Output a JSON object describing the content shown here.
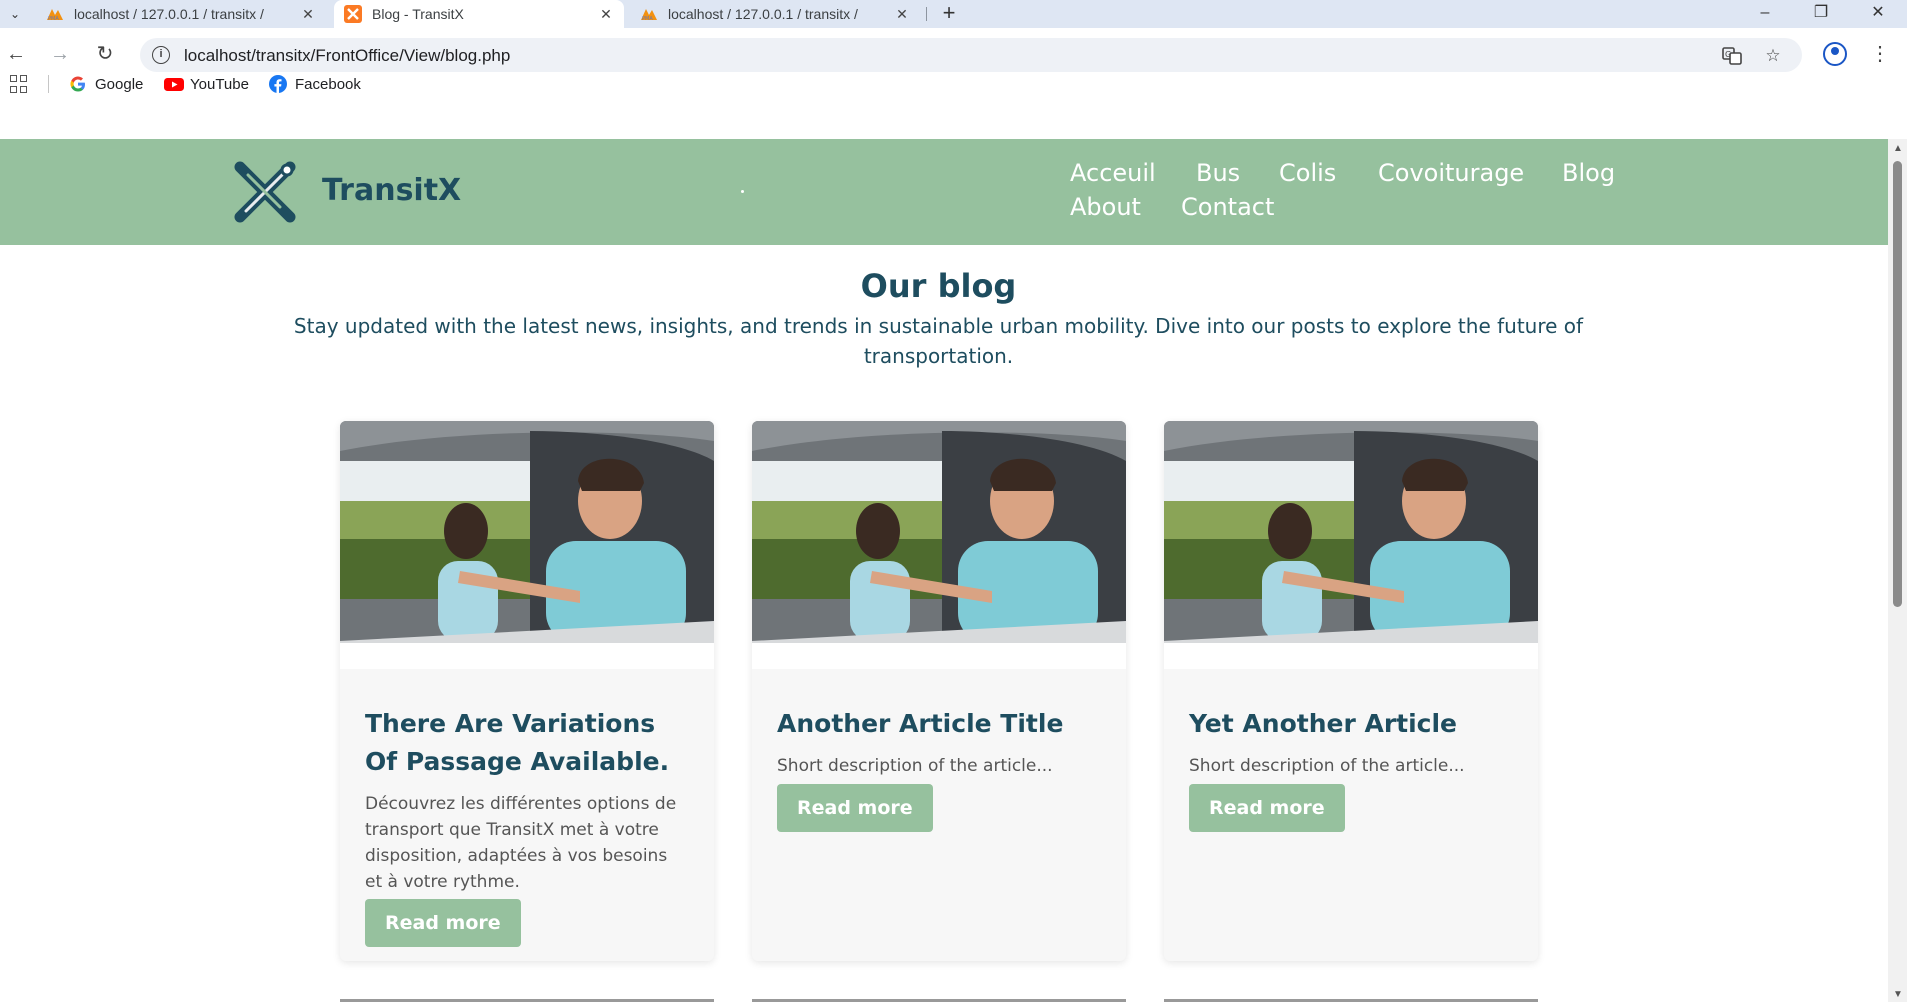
{
  "browser": {
    "tabs": [
      {
        "title": "localhost / 127.0.0.1 / transitx /",
        "active": false
      },
      {
        "title": "Blog - TransitX",
        "active": true
      },
      {
        "title": "localhost / 127.0.0.1 / transitx /",
        "active": false
      }
    ],
    "url": "localhost/transitx/FrontOffice/View/blog.php",
    "bookmarks": [
      {
        "label": "Google"
      },
      {
        "label": "YouTube"
      },
      {
        "label": "Facebook"
      }
    ]
  },
  "site": {
    "brand": "TransitX",
    "nav": [
      "Acceuil",
      "Bus",
      "Colis",
      "Covoiturage",
      "Blog",
      "About",
      "Contact"
    ],
    "colors": {
      "header": "#96c19e",
      "primary_text": "#1e4d5f",
      "button": "#96c19e"
    }
  },
  "blog": {
    "title": "Our blog",
    "subtitle": "Stay updated with the latest news, insights, and trends in sustainable urban mobility. Dive into our posts to explore the future of transportation.",
    "posts": [
      {
        "title": "There Are Variations Of Passage Available.",
        "description": "Découvrez les différentes options de transport que TransitX met à votre disposition, adaptées à vos besoins et à votre rythme.",
        "button": "Read more"
      },
      {
        "title": "Another Article Title",
        "description": "Short description of the article...",
        "button": "Read more"
      },
      {
        "title": "Yet Another Article",
        "description": "Short description of the article...",
        "button": "Read more"
      }
    ]
  }
}
